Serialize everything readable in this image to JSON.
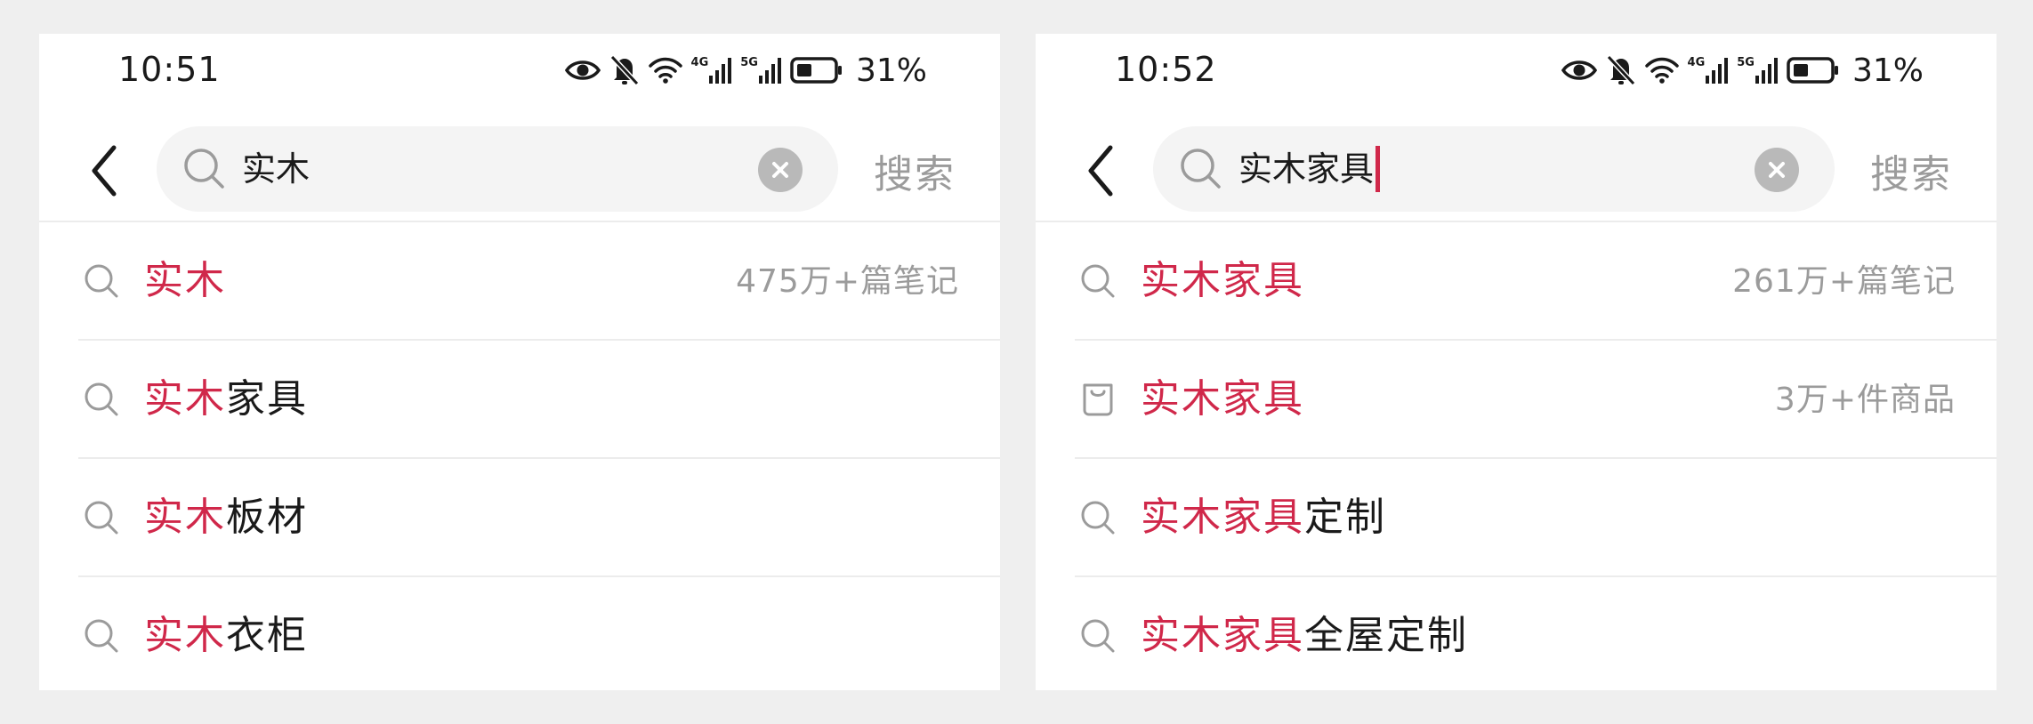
{
  "colors": {
    "background": "#efefef",
    "panel": "#ffffff",
    "highlight": "#d0284a",
    "muted": "#9b9b9b",
    "text": "#1a1a1a",
    "search_box": "#f4f4f4"
  },
  "screens": [
    {
      "status_bar": {
        "time": "10:51",
        "network_4g": "4G",
        "network_5g": "5G",
        "battery": "31%",
        "icons": [
          "eye-icon",
          "bell-muted-icon",
          "wifi-icon",
          "signal-4g-icon",
          "signal-5g-icon",
          "battery-icon"
        ]
      },
      "search": {
        "query": "实木",
        "action_label": "搜索",
        "cursor_visible": false
      },
      "suggestions": [
        {
          "icon": "search-icon",
          "highlight": "实木",
          "rest": "",
          "meta": "475万+篇笔记"
        },
        {
          "icon": "search-icon",
          "highlight": "实木",
          "rest": "家具",
          "meta": ""
        },
        {
          "icon": "search-icon",
          "highlight": "实木",
          "rest": "板材",
          "meta": ""
        },
        {
          "icon": "search-icon",
          "highlight": "实木",
          "rest": "衣柜",
          "meta": ""
        }
      ]
    },
    {
      "status_bar": {
        "time": "10:52",
        "network_4g": "4G",
        "network_5g": "5G",
        "battery": "31%",
        "icons": [
          "eye-icon",
          "bell-muted-icon",
          "wifi-icon",
          "signal-4g-icon",
          "signal-5g-icon",
          "battery-icon"
        ]
      },
      "search": {
        "query": "实木家具",
        "action_label": "搜索",
        "cursor_visible": true
      },
      "suggestions": [
        {
          "icon": "search-icon",
          "highlight": "实木家具",
          "rest": "",
          "meta": "261万+篇笔记"
        },
        {
          "icon": "shopping-bag-icon",
          "highlight": "实木家具",
          "rest": "",
          "meta": "3万+件商品"
        },
        {
          "icon": "search-icon",
          "highlight": "实木家具",
          "rest": "定制",
          "meta": ""
        },
        {
          "icon": "search-icon",
          "highlight": "实木家具",
          "rest": "全屋定制",
          "meta": ""
        }
      ]
    }
  ]
}
